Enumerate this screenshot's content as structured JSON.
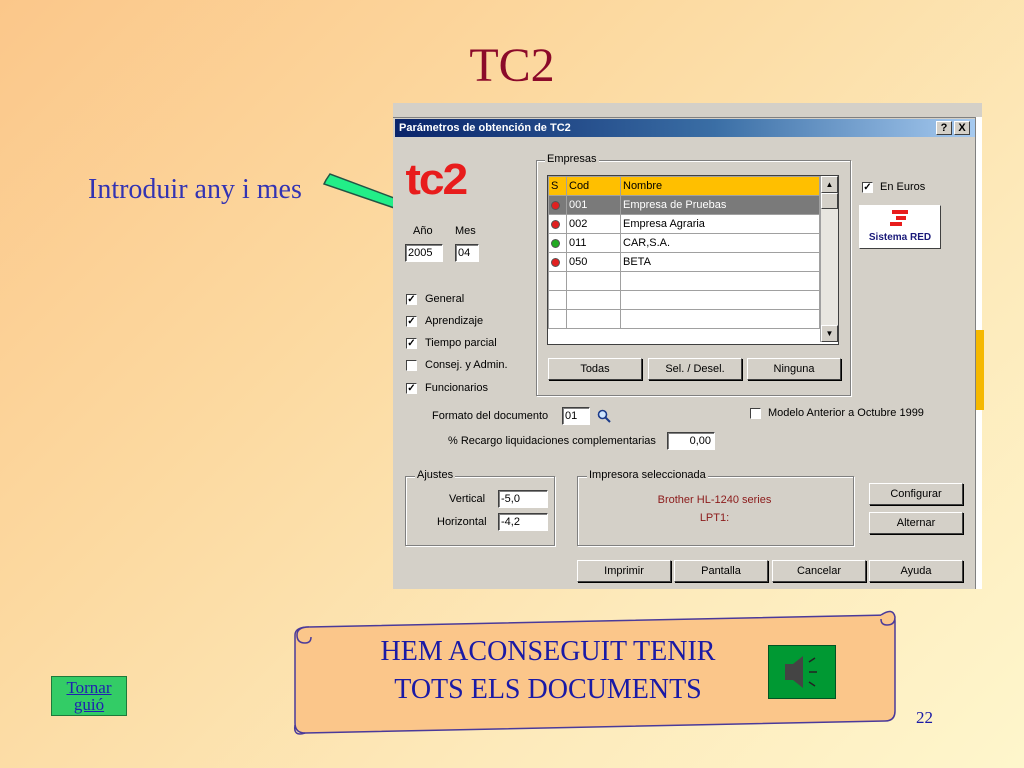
{
  "slide": {
    "title": "TC2",
    "side_note": "Introduir any i mes",
    "page_number": "22"
  },
  "dialog": {
    "title": "Parámetros de obtención de TC2",
    "help_button": "?",
    "close_button": "X",
    "logo_text": "tc2",
    "year_label": "Año",
    "month_label": "Mes",
    "year_value": "2005",
    "month_value": "04",
    "checkboxes": [
      {
        "label": "General",
        "checked": true
      },
      {
        "label": "Aprendizaje",
        "checked": true
      },
      {
        "label": "Tiempo parcial",
        "checked": true
      },
      {
        "label": "Consej. y Admin.",
        "checked": false
      },
      {
        "label": "Funcionarios",
        "checked": true
      }
    ],
    "empresas": {
      "group_title": "Empresas",
      "columns": [
        "S",
        "Cod",
        "Nombre"
      ],
      "rows": [
        {
          "status": "red",
          "cod": "001",
          "nombre": "Empresa de Pruebas",
          "selected": true
        },
        {
          "status": "red",
          "cod": "002",
          "nombre": "Empresa Agraria",
          "selected": false
        },
        {
          "status": "green",
          "cod": "011",
          "nombre": "CAR,S.A.",
          "selected": false
        },
        {
          "status": "red",
          "cod": "050",
          "nombre": "BETA",
          "selected": false
        }
      ],
      "buttons": [
        "Todas",
        "Sel. / Desel.",
        "Ninguna"
      ]
    },
    "en_euros": {
      "label": "En Euros",
      "checked": true
    },
    "sistema_red": "Sistema RED",
    "formato_label": "Formato del documento",
    "formato_value": "01",
    "modelo_anterior": {
      "label": "Modelo Anterior a Octubre 1999",
      "checked": false
    },
    "recargo_label": "% Recargo liquidaciones complementarias",
    "recargo_value": "0,00",
    "ajustes": {
      "group_title": "Ajustes",
      "vertical_label": "Vertical",
      "vertical_value": "-5,0",
      "horizontal_label": "Horizontal",
      "horizontal_value": "-4,2"
    },
    "impresora": {
      "group_title": "Impresora seleccionada",
      "name": "Brother HL-1240 series",
      "port": "LPT1:"
    },
    "side_buttons": [
      "Configurar",
      "Alternar"
    ],
    "bottom_buttons": [
      "Imprimir",
      "Pantalla",
      "Cancelar",
      "Ayuda"
    ]
  },
  "banner": {
    "text_line1": "HEM ACONSEGUIT TENIR",
    "text_line2": "TOTS ELS DOCUMENTS"
  },
  "nav": {
    "tornar_line1": "Tornar",
    "tornar_line2": "guió"
  },
  "colors": {
    "title": "#8b0a2a",
    "text_blue": "#3333b3",
    "grid_header": "#ffbf00",
    "status_red": "#e02020",
    "status_green": "#22aa22",
    "printer_text": "#8b1a1a"
  }
}
